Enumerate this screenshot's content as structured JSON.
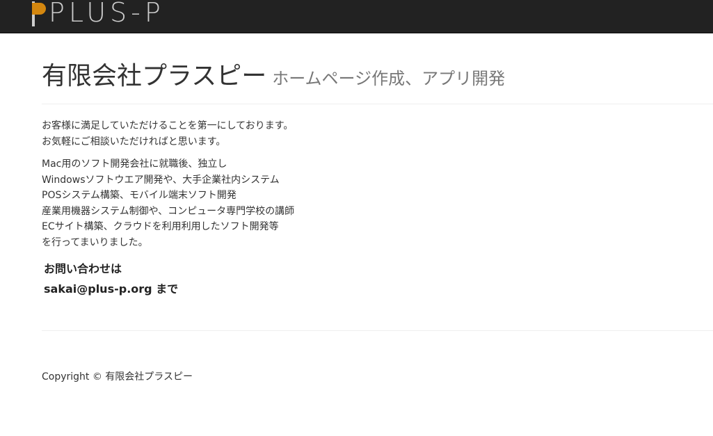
{
  "navbar": {
    "brand": "PLUS-P"
  },
  "header": {
    "title": "有限会社プラスピー",
    "subtitle": "ホームページ作成、アプリ開発"
  },
  "intro": [
    "お客様に満足していただけることを第一にしております。",
    "お気軽にご相談いただければと思います。"
  ],
  "history": [
    "Mac用のソフト開発会社に就職後、独立し",
    "Windowsソフトウエア開発や、大手企業社内システム",
    "POSシステム構築、モバイル端末ソフト開発",
    "産業用機器システム制御や、コンピュータ専門学校の講師",
    "ECサイト構築、クラウドを利用利用したソフト開発等",
    "を行ってまいりました。"
  ],
  "contact": {
    "line1": "お問い合わせは",
    "line2": "sakai@plus-p.org まで"
  },
  "footer": {
    "copyright": "Copyright © 有限会社プラスピー"
  },
  "colors": {
    "navbar_bg": "#222222",
    "logo_accent": "#d4870f"
  }
}
